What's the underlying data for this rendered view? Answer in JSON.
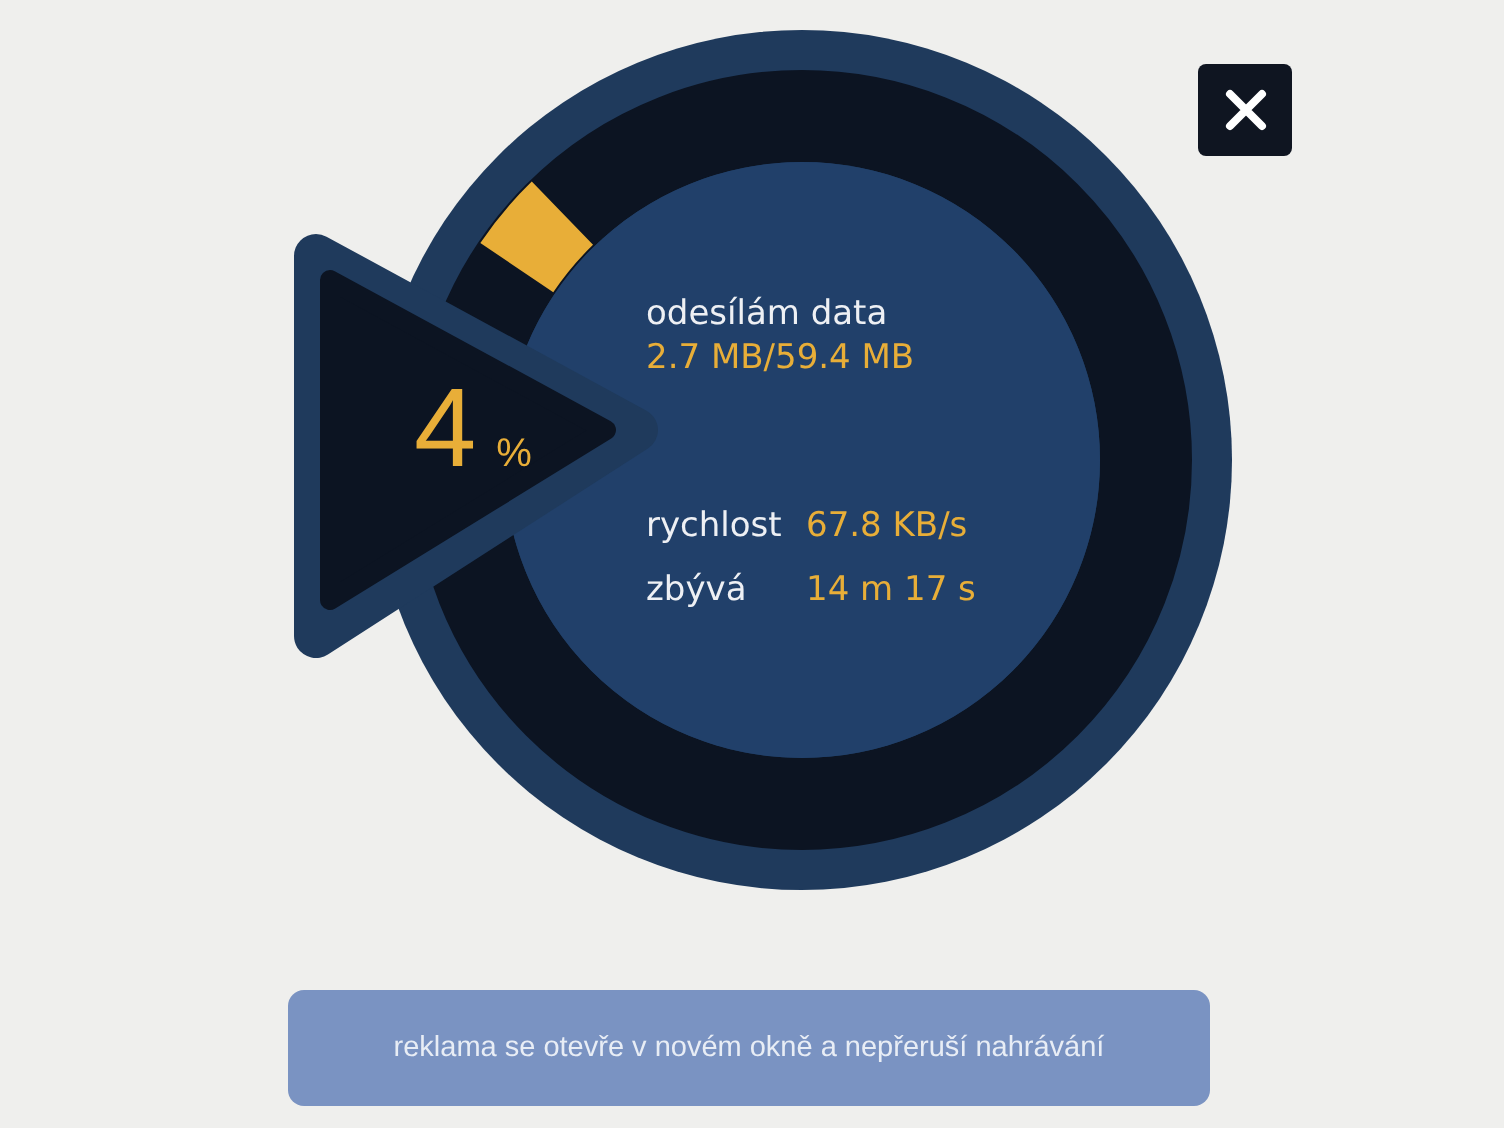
{
  "progress": {
    "percent": "4",
    "unit": "%"
  },
  "status": {
    "label": "odesílám data",
    "value": "2.7 MB/59.4 MB"
  },
  "stats": [
    {
      "label": "rychlost",
      "value": "67.8 KB/s"
    },
    {
      "label": "zbývá",
      "value": "14 m 17 s"
    }
  ],
  "notice": "reklama se otevře v novém okně a nepřeruší nahrávání"
}
